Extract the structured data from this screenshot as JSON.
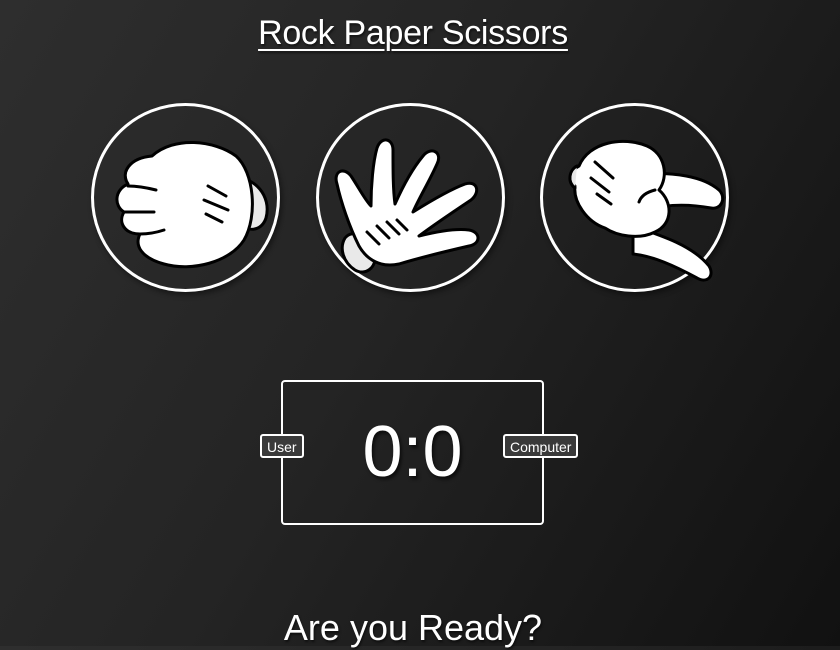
{
  "app": {
    "title": "Rock Paper Scissors"
  },
  "choices": [
    {
      "id": "rock",
      "icon": "rock-hand-icon"
    },
    {
      "id": "paper",
      "icon": "paper-hand-icon"
    },
    {
      "id": "scissors",
      "icon": "scissors-hand-icon"
    }
  ],
  "scoreboard": {
    "user_label": "User",
    "computer_label": "Computer",
    "score": "0:0"
  },
  "message": "Are you Ready?",
  "colors": {
    "background_light": "#2e2e2e",
    "background_dark": "#111111",
    "foreground": "#ffffff",
    "badge_bg": "#3a3a3a"
  }
}
